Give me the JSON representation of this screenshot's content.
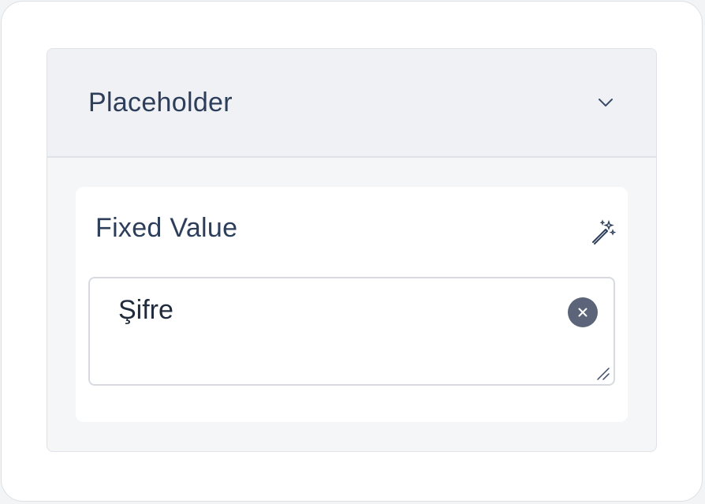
{
  "section": {
    "title": "Placeholder",
    "expand_icon": "chevron-down-icon"
  },
  "field": {
    "label": "Fixed Value",
    "magic_icon": "magic-wand-icon",
    "value": "Şifre",
    "clear_icon": "close-icon"
  },
  "colors": {
    "text": "#2d3e5a",
    "header_bg": "#f0f1f4",
    "clear_button": "#5b6478"
  }
}
